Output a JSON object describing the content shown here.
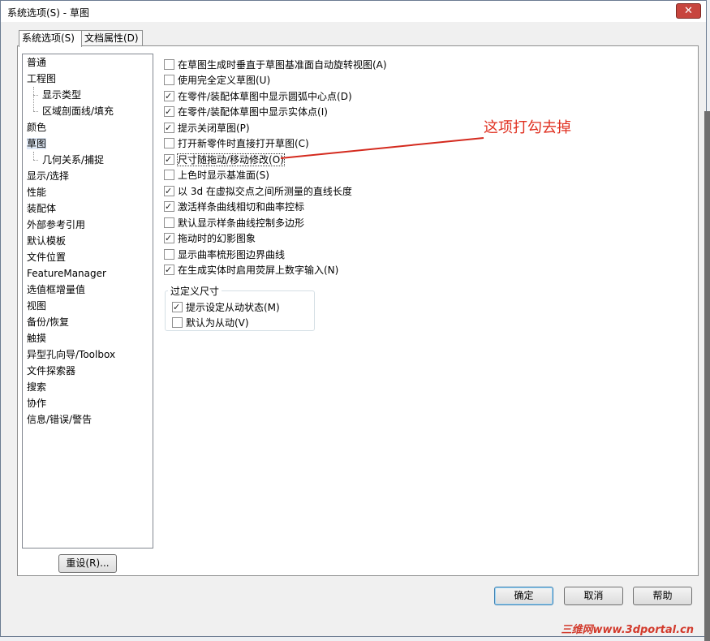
{
  "window": {
    "title": "系统选项(S) - 草图",
    "close_label": "✕"
  },
  "tabs": [
    {
      "label": "系统选项(S)"
    },
    {
      "label": "文档属性(D)"
    }
  ],
  "tree": {
    "items": [
      {
        "label": "普通"
      },
      {
        "label": "工程图"
      },
      {
        "label": "显示类型"
      },
      {
        "label": "区域剖面线/填充"
      },
      {
        "label": "颜色"
      },
      {
        "label": "草图"
      },
      {
        "label": "几何关系/捕捉"
      },
      {
        "label": "显示/选择"
      },
      {
        "label": "性能"
      },
      {
        "label": "装配体"
      },
      {
        "label": "外部参考引用"
      },
      {
        "label": "默认模板"
      },
      {
        "label": "文件位置"
      },
      {
        "label": "FeatureManager"
      },
      {
        "label": "选值框增量值"
      },
      {
        "label": "视图"
      },
      {
        "label": "备份/恢复"
      },
      {
        "label": "触摸"
      },
      {
        "label": "异型孔向导/Toolbox"
      },
      {
        "label": "文件探索器"
      },
      {
        "label": "搜索"
      },
      {
        "label": "协作"
      },
      {
        "label": "信息/错误/警告"
      }
    ]
  },
  "options": [
    {
      "label": "在草图生成时垂直于草图基准面自动旋转视图(A)",
      "checked": false
    },
    {
      "label": "使用完全定义草图(U)",
      "checked": false
    },
    {
      "label": "在零件/装配体草图中显示圆弧中心点(D)",
      "checked": true
    },
    {
      "label": "在零件/装配体草图中显示实体点(I)",
      "checked": true
    },
    {
      "label": "提示关闭草图(P)",
      "checked": true
    },
    {
      "label": "打开新零件时直接打开草图(C)",
      "checked": false
    },
    {
      "label": "尺寸随拖动/移动修改(O)",
      "checked": true
    },
    {
      "label": "上色时显示基准面(S)",
      "checked": false
    },
    {
      "label": "以 3d 在虚拟交点之间所测量的直线长度",
      "checked": true
    },
    {
      "label": "激活样条曲线相切和曲率控标",
      "checked": true
    },
    {
      "label": "默认显示样条曲线控制多边形",
      "checked": false
    },
    {
      "label": "拖动时的幻影图象",
      "checked": true
    },
    {
      "label": "显示曲率梳形图边界曲线",
      "checked": false
    },
    {
      "label": "在生成实体时启用荧屏上数字输入(N)",
      "checked": true
    }
  ],
  "overdefined": {
    "title": "过定义尺寸",
    "options": [
      {
        "label": "提示设定从动状态(M)",
        "checked": true
      },
      {
        "label": "默认为从动(V)",
        "checked": false
      }
    ]
  },
  "buttons": {
    "reset": "重设(R)...",
    "ok": "确定",
    "cancel": "取消",
    "help": "帮助"
  },
  "annotation": {
    "text": "这项打勾去掉",
    "color": "#e03020"
  },
  "watermark": "三维网www.3dportal.cn"
}
